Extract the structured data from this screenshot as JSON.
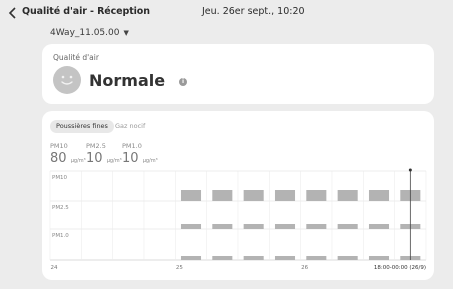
{
  "header": {
    "title": "Qualité d'air - Réception",
    "datetime": "Jeu. 26er sept., 10:20"
  },
  "device": {
    "name": "4Way_11.05.00"
  },
  "air_quality": {
    "label": "Qualité d'air",
    "status": "Normale",
    "info_glyph": "i"
  },
  "tabs": {
    "active": "Poussières fines",
    "inactive": "Gaz nocif"
  },
  "metrics": [
    {
      "label": "PM10",
      "value": "80",
      "unit": "μg/m³"
    },
    {
      "label": "PM2.5",
      "value": "10",
      "unit": "μg/m³"
    },
    {
      "label": "PM1.0",
      "value": "10",
      "unit": "μg/m³"
    }
  ],
  "chart_data": {
    "type": "bar",
    "x_tick_labels": [
      "24",
      "25",
      "26"
    ],
    "range_label": "18:00-00:00 (26/9)",
    "series": [
      {
        "name": "PM10",
        "values": [
          0,
          0,
          0,
          0,
          1,
          1,
          1,
          1,
          1,
          1,
          1,
          1
        ]
      },
      {
        "name": "PM2.5",
        "values": [
          0,
          0,
          0,
          0,
          1,
          1,
          1,
          1,
          1,
          1,
          1,
          1
        ]
      },
      {
        "name": "PM1.0",
        "values": [
          0,
          0,
          0,
          0,
          1,
          1,
          1,
          1,
          1,
          1,
          1,
          1
        ]
      }
    ],
    "grid": true,
    "bar_color": "#b3b3b3"
  }
}
